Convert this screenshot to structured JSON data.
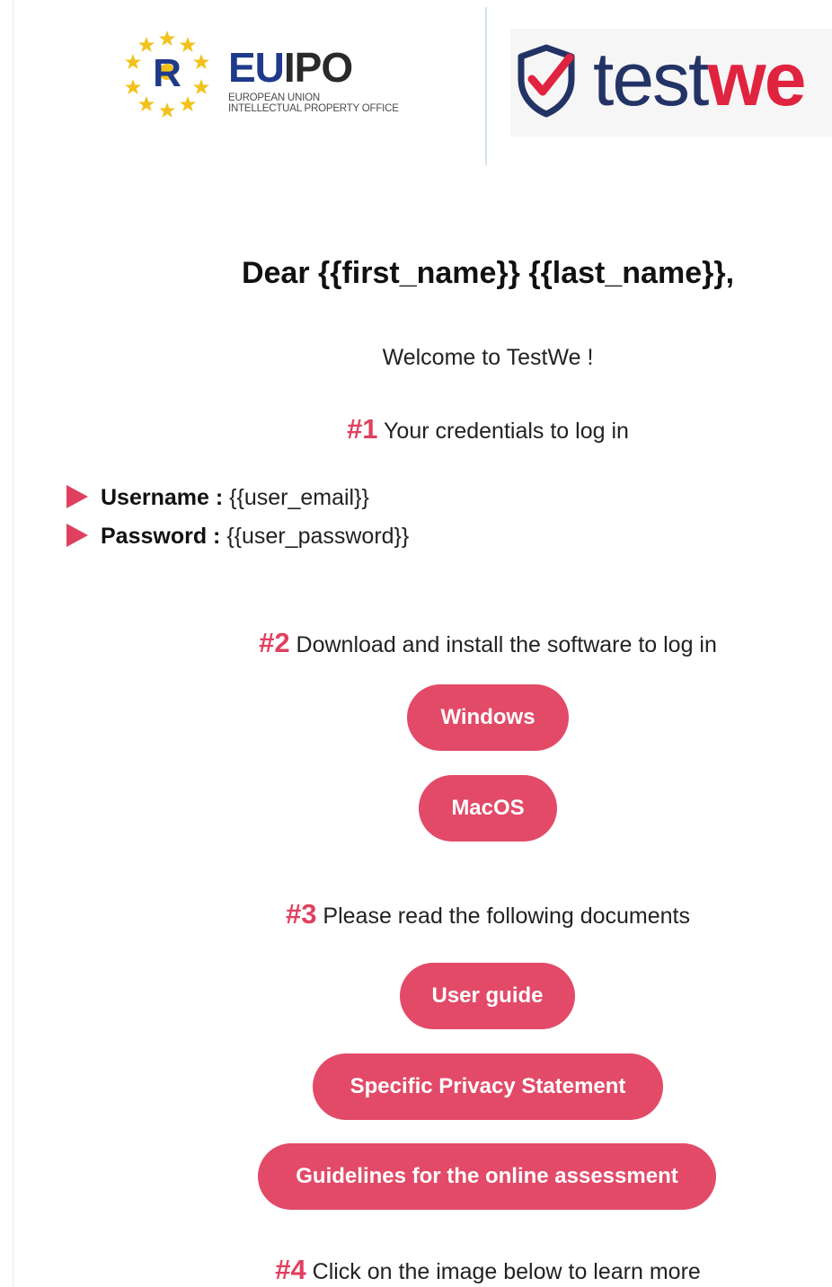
{
  "header": {
    "euipo": {
      "word_eu": "EU",
      "word_ipo": "IPO",
      "subtitle_line1": "EUROPEAN UNION",
      "subtitle_line2": "INTELLECTUAL PROPERTY OFFICE",
      "emblem_letter": "R",
      "colors": {
        "blue": "#1f3a8a",
        "star": "#f2c21b",
        "dark": "#2a2a2a"
      }
    },
    "testwe": {
      "word_test": "test",
      "word_we": "we",
      "colors": {
        "navy": "#233366",
        "red": "#e0233f"
      }
    }
  },
  "greeting": "Dear {{first_name}} {{last_name}},",
  "welcome": "Welcome to TestWe !",
  "steps": [
    {
      "number": "#1",
      "text": "Your credentials to log in"
    },
    {
      "number": "#2",
      "text": "Download and install the software to log in"
    },
    {
      "number": "#3",
      "text": "Please read the following documents"
    },
    {
      "number": "#4",
      "text": "Click on the image below to learn more"
    }
  ],
  "credentials": {
    "username_label": "Username :",
    "username_value": "{{user_email}}",
    "password_label": "Password :",
    "password_value": "{{user_password}}"
  },
  "downloads": {
    "windows": "Windows",
    "macos": "MacOS"
  },
  "documents": {
    "user_guide": "User guide",
    "privacy": "Specific Privacy Statement",
    "guidelines": "Guidelines for the online assessment"
  },
  "colors": {
    "accent": "#e24a68",
    "step_number": "#e0405f"
  }
}
